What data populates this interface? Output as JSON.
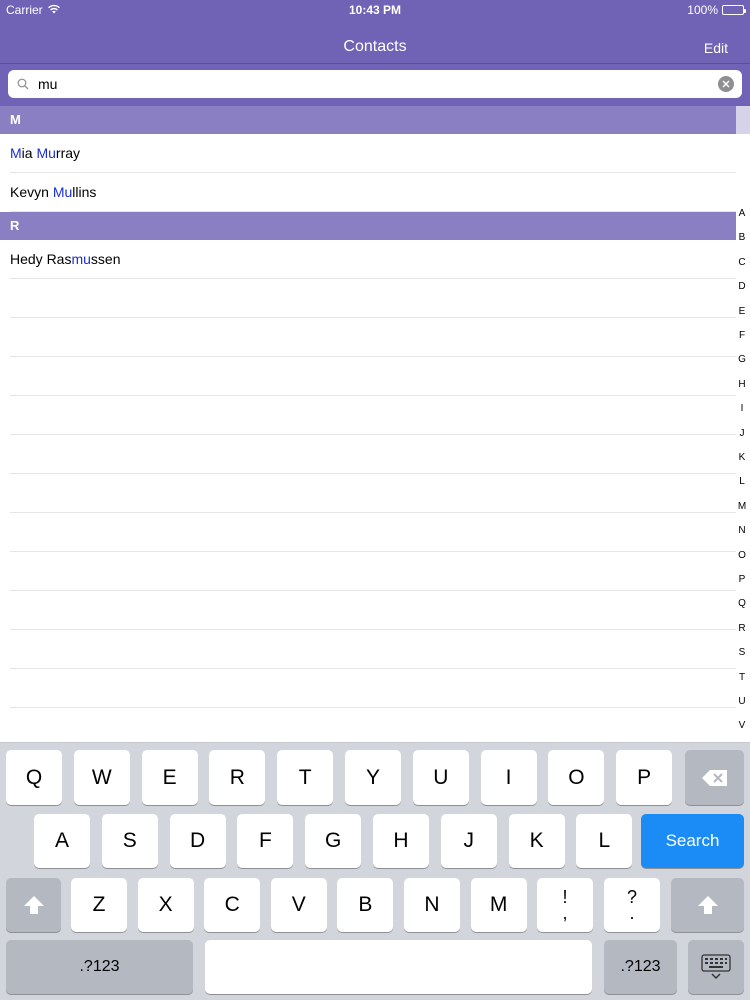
{
  "status_bar": {
    "carrier": "Carrier",
    "time": "10:43 PM",
    "battery": "100%"
  },
  "nav": {
    "title": "Contacts",
    "edit_label": "Edit"
  },
  "search": {
    "value": "mu",
    "placeholder": ""
  },
  "sections": [
    {
      "header": "M",
      "rows": [
        {
          "parts": [
            {
              "t": "M",
              "h": true
            },
            {
              "t": "ia ",
              "h": false
            },
            {
              "t": "Mu",
              "h": true
            },
            {
              "t": "rray",
              "h": false
            }
          ]
        },
        {
          "parts": [
            {
              "t": "Kevyn ",
              "h": false
            },
            {
              "t": "Mu",
              "h": true
            },
            {
              "t": "llins",
              "h": false
            }
          ]
        }
      ]
    },
    {
      "header": "R",
      "rows": [
        {
          "parts": [
            {
              "t": "Hedy Ras",
              "h": false
            },
            {
              "t": "mu",
              "h": true
            },
            {
              "t": "ssen",
              "h": false
            }
          ]
        }
      ]
    }
  ],
  "index_letters": [
    "A",
    "B",
    "C",
    "D",
    "E",
    "F",
    "G",
    "H",
    "I",
    "J",
    "K",
    "L",
    "M",
    "N",
    "O",
    "P",
    "Q",
    "R",
    "S",
    "T",
    "U",
    "V"
  ],
  "keyboard": {
    "row1": [
      "Q",
      "W",
      "E",
      "R",
      "T",
      "Y",
      "U",
      "I",
      "O",
      "P"
    ],
    "row2": [
      "A",
      "S",
      "D",
      "F",
      "G",
      "H",
      "J",
      "K",
      "L"
    ],
    "row3": [
      "Z",
      "X",
      "C",
      "V",
      "B",
      "N",
      "M"
    ],
    "exclaim_top": "!",
    "exclaim_bottom": ",",
    "question_top": "?",
    "question_bottom": ".",
    "search_label": "Search",
    "numbers_label": ".?123"
  },
  "colors": {
    "nav_bg": "#7063b6",
    "section_bg": "#8b7fc4",
    "highlight": "#1b2fd6",
    "search_key": "#1b8cf5"
  }
}
